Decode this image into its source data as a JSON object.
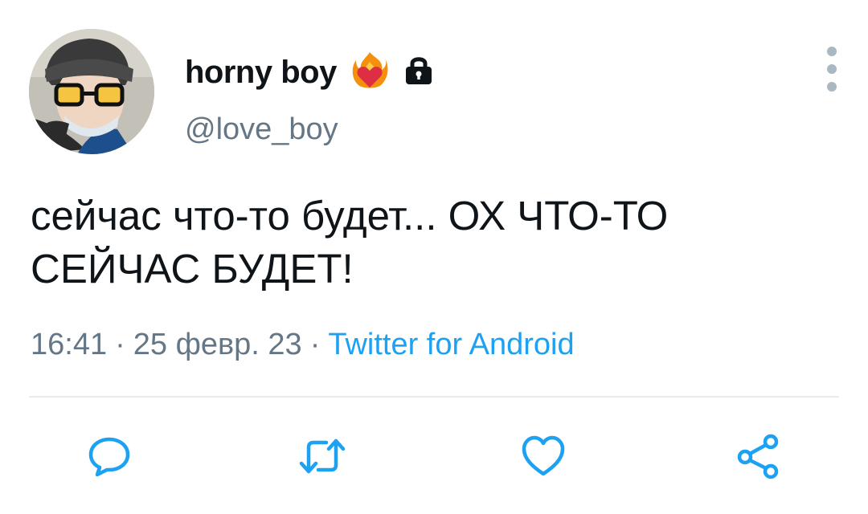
{
  "tweet": {
    "display_name": "horny boy",
    "handle": "@love_boy",
    "text": "сейчас что-то будет... ОХ ЧТО-ТО СЕЙЧАС БУДЕТ!",
    "time": "16:41",
    "separator": "·",
    "date": "25 февр. 23",
    "source": "Twitter for Android",
    "badges": [
      "heart-on-fire-icon",
      "lock-icon"
    ]
  },
  "actions": [
    "reply-icon",
    "retweet-icon",
    "like-icon",
    "share-icon"
  ],
  "colors": {
    "text": "#0f1419",
    "secondary": "#657786",
    "link": "#1da1f2",
    "icon": "#1da1f2",
    "divider": "#e6ecf0"
  }
}
